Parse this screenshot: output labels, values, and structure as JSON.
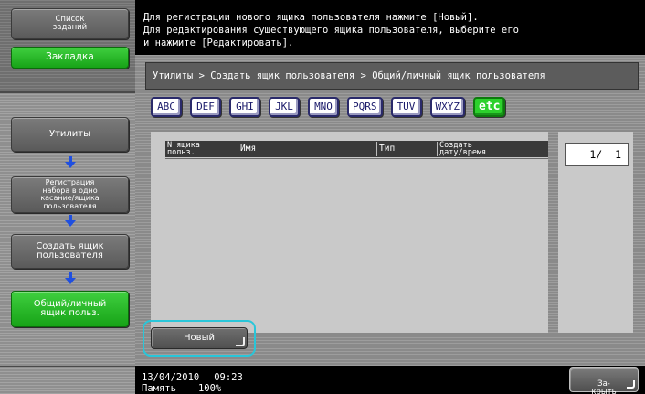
{
  "sidebar": {
    "job_list_label": "Список\nзаданий",
    "bookmark_label": "Закладка",
    "steps": [
      {
        "label": "Утилиты"
      },
      {
        "label": "Регистрация\nнабора в одно\nкасание/ящика\nпользователя"
      },
      {
        "label": "Создать ящик\nпользователя"
      },
      {
        "label": "Общий/личный\nящик польз."
      }
    ]
  },
  "message": "Для регистрации нового ящика пользователя нажмите [Новый].\nДля редактирования существующего ящика пользователя, выберите его\nи нажмите [Редактировать].",
  "breadcrumb": "Утилиты > Создать ящик пользователя > Общий/личный ящик пользователя",
  "index_tabs": [
    "ABC",
    "DEF",
    "GHI",
    "JKL",
    "MNO",
    "PQRS",
    "TUV",
    "WXYZ",
    "etc"
  ],
  "active_tab": "etc",
  "table": {
    "columns": [
      "N ящика\nпольз.",
      "Имя",
      "Тип",
      "Создать\nдату/время"
    ]
  },
  "page_indicator": "1/  1",
  "new_button_label": "Новый",
  "status": {
    "date": "13/04/2010",
    "time": "09:23",
    "memory_label": "Память",
    "memory_value": "100%"
  },
  "close_button_label": "За-\nкрыть",
  "colors": {
    "accent_green": "#2cd12c",
    "highlight_cyan": "#29c6d9",
    "tab_blue": "#1a1a6a"
  }
}
